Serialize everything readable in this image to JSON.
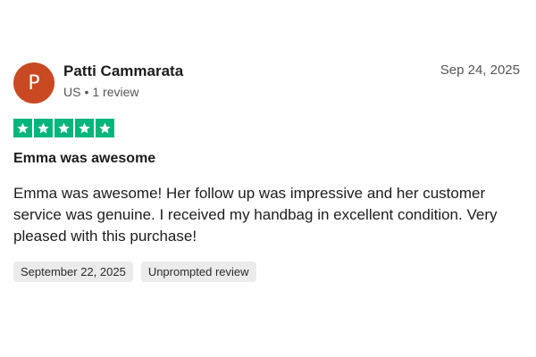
{
  "reviewer": {
    "initial": "P",
    "name": "Patti Cammarata",
    "country": "US",
    "separator": "•",
    "review_count": "1 review",
    "avatar_color": "#c94a22"
  },
  "review": {
    "date": "Sep 24, 2025",
    "rating": 5,
    "rating_max": 5,
    "star_color": "#00b67a",
    "title": "Emma was awesome",
    "body": "Emma was awesome! Her follow up was impressive and her customer service was genuine. I received my handbag in excellent condition. Very pleased with this purchase!",
    "tags": [
      {
        "label": "September 22, 2025"
      },
      {
        "label": "Unprompted review"
      }
    ]
  }
}
